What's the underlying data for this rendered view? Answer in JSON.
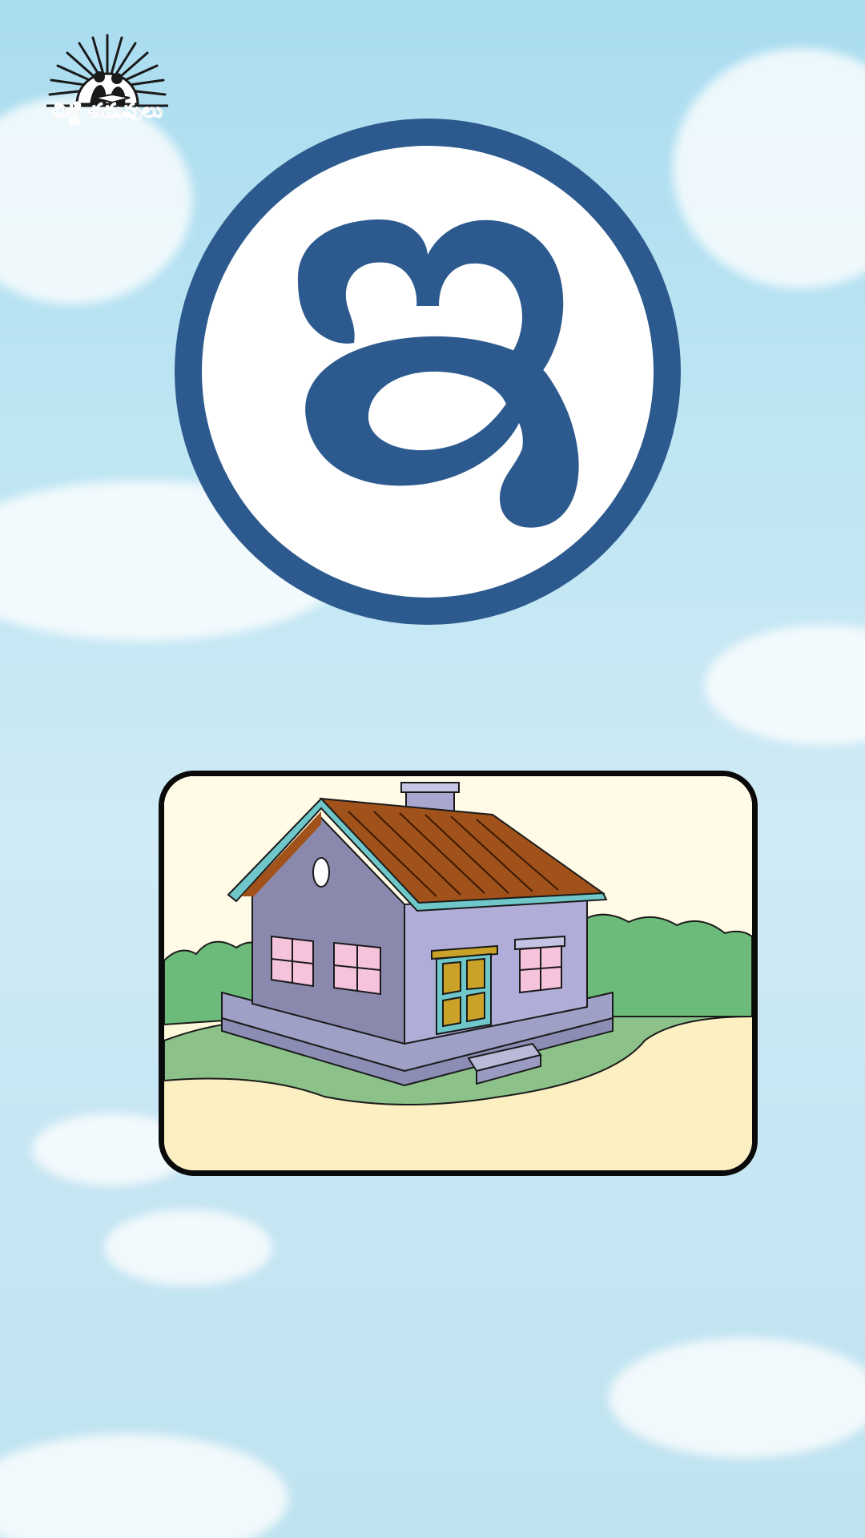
{
  "logo": {
    "text": "చిట్టి చదువులు",
    "icon": "sunrise-children-reading-logo"
  },
  "letter": {
    "glyph": "ఇ",
    "ring_color": "#2d5a8e"
  },
  "picture": {
    "icon": "house-illustration"
  },
  "colors": {
    "sky": "#bfe6f3",
    "letter_blue": "#2d5a8e",
    "card_border": "#0a0a0a",
    "card_background": "#fdf6d4",
    "roof": "#a0521a",
    "wall": "#a9a7d0",
    "bush": "#6dbb7a",
    "window": "#f6c3dc"
  }
}
